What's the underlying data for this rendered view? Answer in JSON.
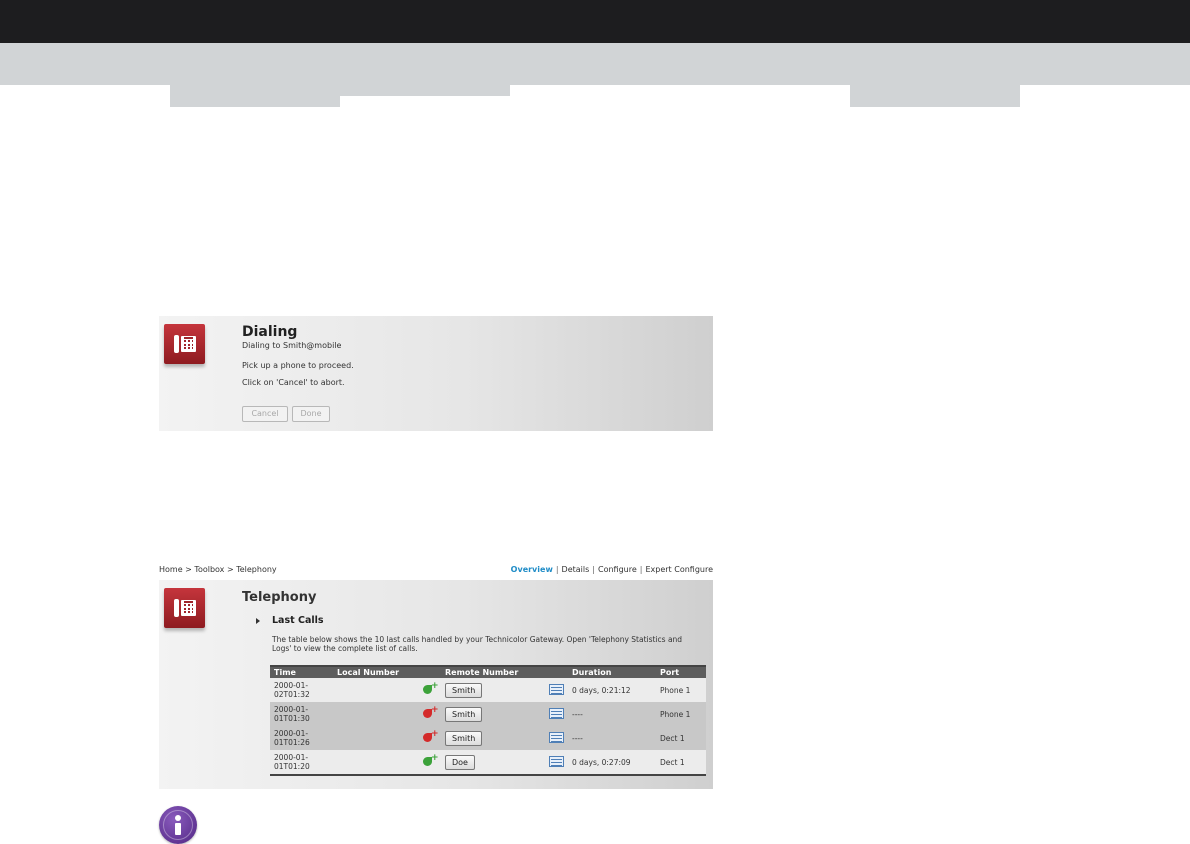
{
  "dialing": {
    "title": "Dialing",
    "line1": "Dialing to Smith@mobile",
    "line2": "Pick up a phone to proceed.",
    "line3": "Click on 'Cancel' to abort.",
    "cancel_label": "Cancel",
    "done_label": "Done"
  },
  "breadcrumb": {
    "text": "Home > Toolbox > Telephony"
  },
  "topnav": {
    "items": [
      "Overview",
      "Details",
      "Configure",
      "Expert Configure"
    ],
    "separator": "|"
  },
  "telephony": {
    "title": "Telephony",
    "section_title": "Last Calls",
    "description": "The table below shows the 10 last calls handled by your Technicolor Gateway. Open 'Telephony Statistics and Logs' to view the complete list of calls.",
    "columns": [
      "Time",
      "Local Number",
      "Remote Number",
      "Duration",
      "Port"
    ],
    "rows": [
      {
        "time_a": "2000-01-",
        "time_b": "02T01:32",
        "call_type": "incoming-answered",
        "remote": "Smith",
        "duration": "0 days, 0:21:12",
        "port": "Phone 1"
      },
      {
        "time_a": "2000-01-",
        "time_b": "01T01:30",
        "call_type": "missed",
        "remote": "Smith",
        "duration": "----",
        "port": "Phone 1"
      },
      {
        "time_a": "2000-01-",
        "time_b": "01T01:26",
        "call_type": "missed",
        "remote": "Smith",
        "duration": "----",
        "port": "Dect 1"
      },
      {
        "time_a": "2000-01-",
        "time_b": "01T01:20",
        "call_type": "incoming-answered",
        "remote": "Doe",
        "duration": "0 days, 0:27:09",
        "port": "Dect 1"
      }
    ]
  },
  "colors": {
    "top_bar": "#1d1d1f",
    "sub_bar": "#d1d4d6",
    "active_link": "#1f8cc7",
    "answered_icon": "#3ca23a",
    "missed_icon": "#d42a2a",
    "info_icon": "#5e2f94"
  }
}
